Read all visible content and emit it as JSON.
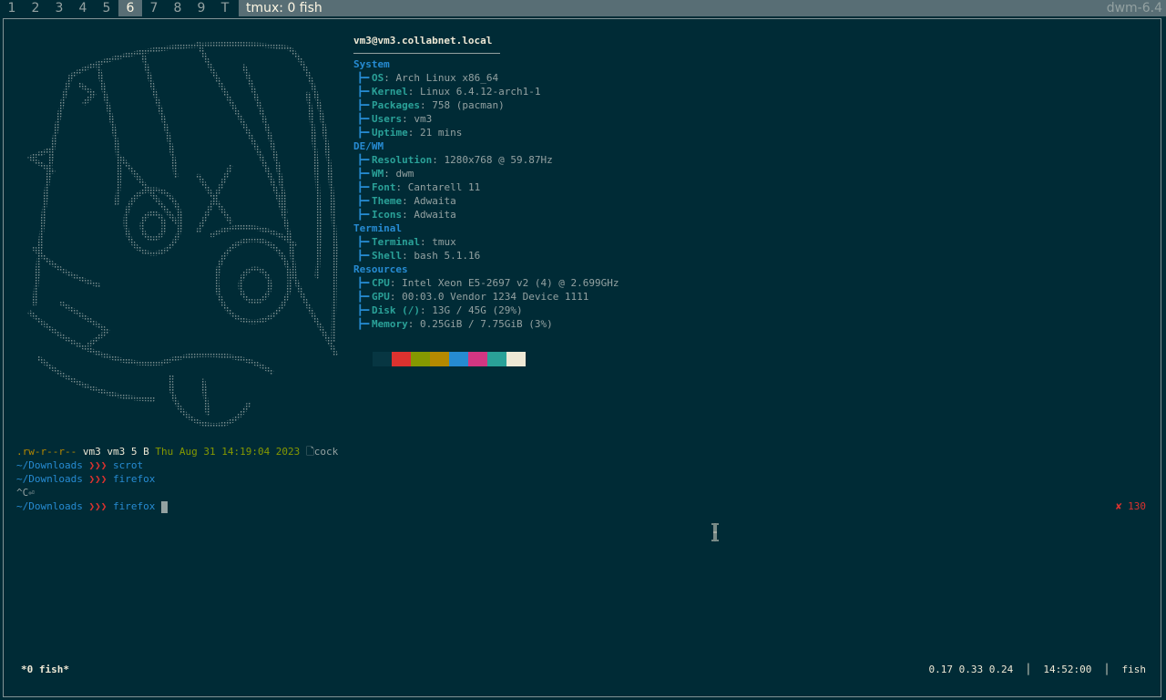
{
  "dwm": {
    "tags": [
      "1",
      "2",
      "3",
      "4",
      "5",
      "6",
      "7",
      "8",
      "9"
    ],
    "active_tag": "6",
    "layout_symbol": "T",
    "window_title": "tmux: 0 fish",
    "version": "dwm-6.4"
  },
  "neofetch": {
    "host": "vm3@vm3.collabnet.local",
    "sections": [
      {
        "title": "System",
        "rows": [
          {
            "key": "OS",
            "value": "Arch Linux x86_64"
          },
          {
            "key": "Kernel",
            "value": "Linux 6.4.12-arch1-1"
          },
          {
            "key": "Packages",
            "value": "758 (pacman)"
          },
          {
            "key": "Users",
            "value": "vm3"
          },
          {
            "key": "Uptime",
            "value": "21 mins"
          }
        ]
      },
      {
        "title": "DE/WM",
        "rows": [
          {
            "key": "Resolution",
            "value": "1280x768 @ 59.87Hz"
          },
          {
            "key": "WM",
            "value": "dwm"
          },
          {
            "key": "Font",
            "value": "Cantarell 11"
          },
          {
            "key": "Theme",
            "value": "Adwaita"
          },
          {
            "key": "Icons",
            "value": "Adwaita"
          }
        ]
      },
      {
        "title": "Terminal",
        "rows": [
          {
            "key": "Terminal",
            "value": "tmux"
          },
          {
            "key": "Shell",
            "value": "bash 5.1.16"
          }
        ]
      },
      {
        "title": "Resources",
        "rows": [
          {
            "key": "CPU",
            "value": "Intel Xeon E5-2697 v2 (4) @ 2.699GHz"
          },
          {
            "key": "GPU",
            "value": "00:03.0 Vendor 1234 Device 1111"
          },
          {
            "key": "Disk (/)",
            "value": "13G / 45G (29%)"
          },
          {
            "key": "Memory",
            "value": "0.25GiB / 7.75GiB (3%)"
          }
        ]
      }
    ],
    "palette": [
      "#073642",
      "#dc322f",
      "#859900",
      "#b58900",
      "#268bd2",
      "#d33682",
      "#2aa198",
      "#eee8d5"
    ]
  },
  "terminal": {
    "ls_line": {
      "perms": ".rw-r--r--",
      "owner": "vm3",
      "group": "vm3",
      "size": "5 B",
      "date": "Thu Aug 31 14:19:04 2023",
      "filename": "cock"
    },
    "history": [
      {
        "cwd": "~/Downloads",
        "prompt": "❯❯❯",
        "command": "scrot"
      },
      {
        "cwd": "~/Downloads",
        "prompt": "❯❯❯",
        "command": "firefox"
      }
    ],
    "interrupt": "^C⏎",
    "current": {
      "cwd": "~/Downloads",
      "prompt": "❯❯❯",
      "command": "firefox"
    },
    "exit_status": "✘ 130"
  },
  "tmux": {
    "window": "*0 fish*",
    "load": "0.17 0.33 0.24",
    "time": "14:52:00",
    "session": "fish"
  }
}
